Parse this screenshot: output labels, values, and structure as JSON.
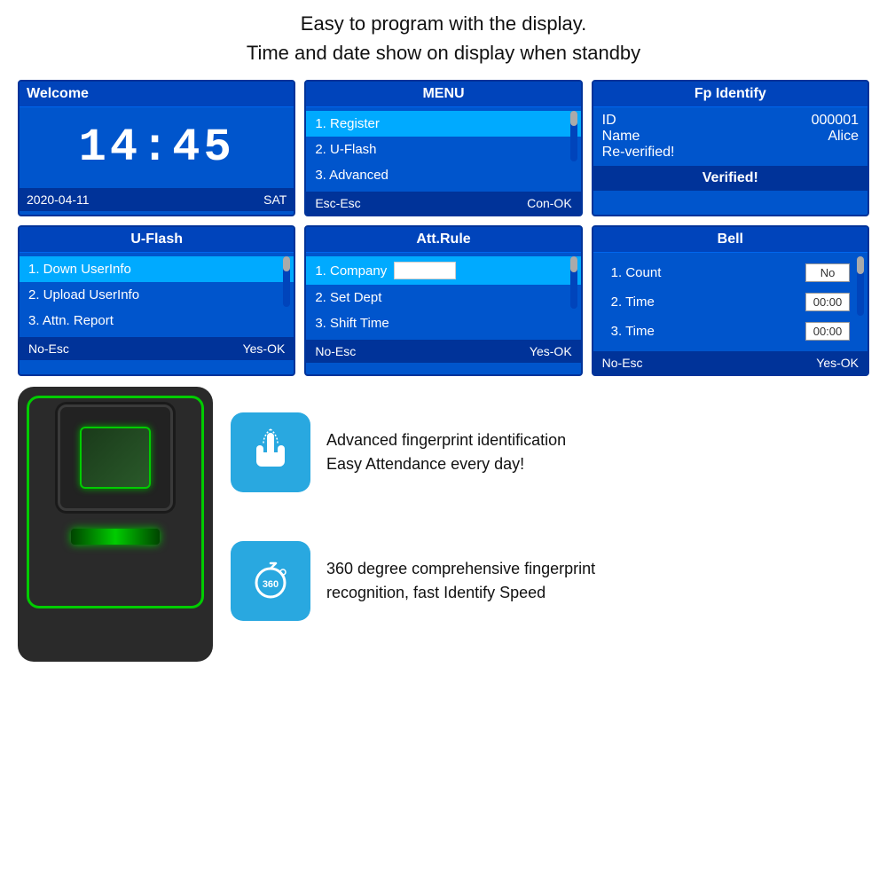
{
  "header": {
    "line1": "Easy to program with the display.",
    "line2": "Time and date show on display when standby"
  },
  "screens": {
    "welcome": {
      "title": "Welcome",
      "clock": "14:45",
      "date": "2020-04-11",
      "day": "SAT"
    },
    "menu": {
      "title": "MENU",
      "items": [
        "1. Register",
        "2. U-Flash",
        "3. Advanced"
      ],
      "active_index": 0,
      "footer_left": "Esc-Esc",
      "footer_right": "Con-OK"
    },
    "fp_identify": {
      "title": "Fp Identify",
      "id_label": "ID",
      "id_value": "000001",
      "name_label": "Name",
      "name_value": "Alice",
      "status_line": "Re-verified!",
      "verified": "Verified!"
    },
    "uflash": {
      "title": "U-Flash",
      "items": [
        "1. Down UserInfo",
        "2. Upload UserInfo",
        "3. Attn. Report"
      ],
      "active_index": 0,
      "footer_left": "No-Esc",
      "footer_right": "Yes-OK"
    },
    "att_rule": {
      "title": "Att.Rule",
      "items": [
        "1. Company",
        "2. Set Dept",
        "3. Shift Time"
      ],
      "active_index": 0,
      "footer_left": "No-Esc",
      "footer_right": "Yes-OK"
    },
    "bell": {
      "title": "Bell",
      "items": [
        {
          "label": "1. Count",
          "value": "No"
        },
        {
          "label": "2. Time",
          "value": "00:00"
        },
        {
          "label": "3. Time",
          "value": "00:00"
        }
      ],
      "footer_left": "No-Esc",
      "footer_right": "Yes-OK"
    }
  },
  "features": [
    {
      "icon": "finger-touch",
      "text_line1": "Advanced fingerprint identification",
      "text_line2": "Easy Attendance every day!"
    },
    {
      "icon": "360-rotate",
      "text_line1": "360 degree comprehensive fingerprint",
      "text_line2": "recognition, fast Identify Speed"
    }
  ]
}
